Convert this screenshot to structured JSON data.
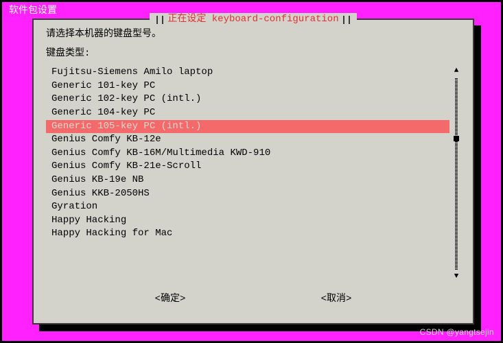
{
  "window_title": "软件包设置",
  "dialog": {
    "title": "正在设定 keyboard-configuration",
    "prompt": "请选择本机器的键盘型号。",
    "list_label": "键盘类型:",
    "selected_index": 4,
    "items": [
      "Fujitsu-Siemens Amilo laptop",
      "Generic 101-key PC",
      "Generic 102-key PC (intl.)",
      "Generic 104-key PC",
      "Generic 105-key PC (intl.)",
      "Genius Comfy KB-12e",
      "Genius Comfy KB-16M/Multimedia KWD-910",
      "Genius Comfy KB-21e-Scroll",
      "Genius KB-19e NB",
      "Genius KKB-2050HS",
      "Gyration",
      "Happy Hacking",
      "Happy Hacking for Mac"
    ],
    "ok_label": "<确定>",
    "cancel_label": "<取消>"
  },
  "watermark": "CSDN @yangtsejin"
}
